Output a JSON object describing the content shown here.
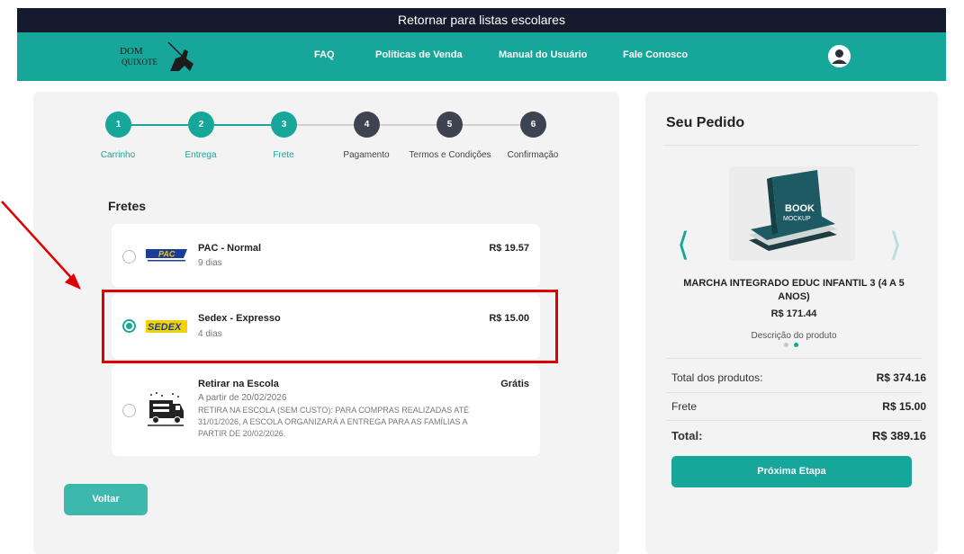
{
  "topbar": {
    "label": "Retornar para listas escolares"
  },
  "nav": {
    "logo_text_top": "DOM",
    "logo_text_bottom": "QUIXOTE",
    "links": [
      "FAQ",
      "Políticas de Venda",
      "Manual do Usuário",
      "Fale Conosco"
    ]
  },
  "steps": [
    {
      "num": "1",
      "label": "Carrinho",
      "done": true
    },
    {
      "num": "2",
      "label": "Entrega",
      "done": true
    },
    {
      "num": "3",
      "label": "Frete",
      "done": true
    },
    {
      "num": "4",
      "label": "Pagamento",
      "done": false
    },
    {
      "num": "5",
      "label": "Termos e Condições",
      "done": false
    },
    {
      "num": "6",
      "label": "Confirmação",
      "done": false
    }
  ],
  "shipping": {
    "title": "Fretes",
    "options": [
      {
        "logo": "PAC",
        "name": "PAC - Normal",
        "days": "9 dias",
        "price": "R$ 19.57",
        "selected": false
      },
      {
        "logo": "SEDEX",
        "name": "Sedex - Expresso",
        "days": "4 dias",
        "price": "R$ 15.00",
        "selected": true
      },
      {
        "logo": "truck",
        "name": "Retirar na Escola",
        "days": "A partir de 20/02/2026",
        "description": "RETIRA NA ESCOLA (SEM CUSTO): PARA COMPRAS REALIZADAS ATÉ 31/01/2026, A ESCOLA ORGANIZARÁ A ENTREGA PARA AS FAMÍLIAS A PARTIR DE 20/02/2026.",
        "price": "Grátis",
        "selected": false
      }
    ]
  },
  "back_button": "Voltar",
  "order": {
    "title": "Seu Pedido",
    "book_text_top": "BOOK",
    "book_text_bottom": "MOCKUP",
    "product_name": "MARCHA INTEGRADO EDUC INFANTIL 3 (4 A 5 ANOS)",
    "product_price": "R$ 171.44",
    "product_desc": "Descrição do produto",
    "carousel_active": 2,
    "summary": [
      {
        "label": "Total dos produtos:",
        "value": "R$ 374.16"
      },
      {
        "label": "Frete",
        "value": "R$ 15.00"
      },
      {
        "label": "Total:",
        "value": "R$ 389.16"
      }
    ],
    "next_button": "Próxima Etapa"
  },
  "colors": {
    "teal": "#16a79a",
    "dark": "#151b2c",
    "step_pending": "#3d4350",
    "highlight": "#e00000"
  }
}
